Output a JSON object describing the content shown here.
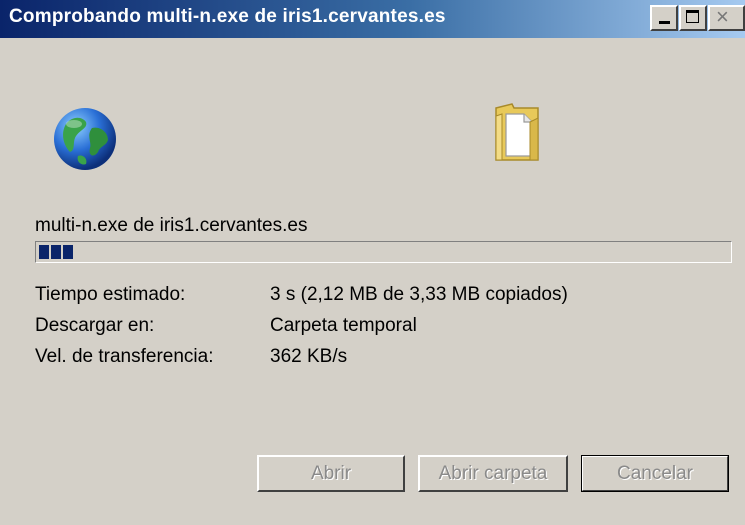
{
  "window": {
    "title": "Comprobando multi-n.exe de iris1.cervantes.es",
    "close_glyph": "×"
  },
  "icons": {
    "left": "globe-icon",
    "right": "folder-icon"
  },
  "download": {
    "file_label": "multi-n.exe de iris1.cervantes.es",
    "progress_segments": 3,
    "progress_fraction": 0.04
  },
  "details": {
    "time_label": "Tiempo estimado:",
    "time_value": "3 s (2,12 MB de 3,33 MB copiados)",
    "dest_label": "Descargar en:",
    "dest_value": "Carpeta temporal",
    "rate_label": "Vel. de transferencia:",
    "rate_value": "362 KB/s"
  },
  "buttons": {
    "open": "Abrir",
    "open_folder": "Abrir carpeta",
    "cancel": "Cancelar"
  },
  "colors": {
    "titlebar_start": "#0a246a",
    "titlebar_end": "#a6caf0",
    "progress": "#0a246a",
    "face": "#d4d0c8"
  }
}
